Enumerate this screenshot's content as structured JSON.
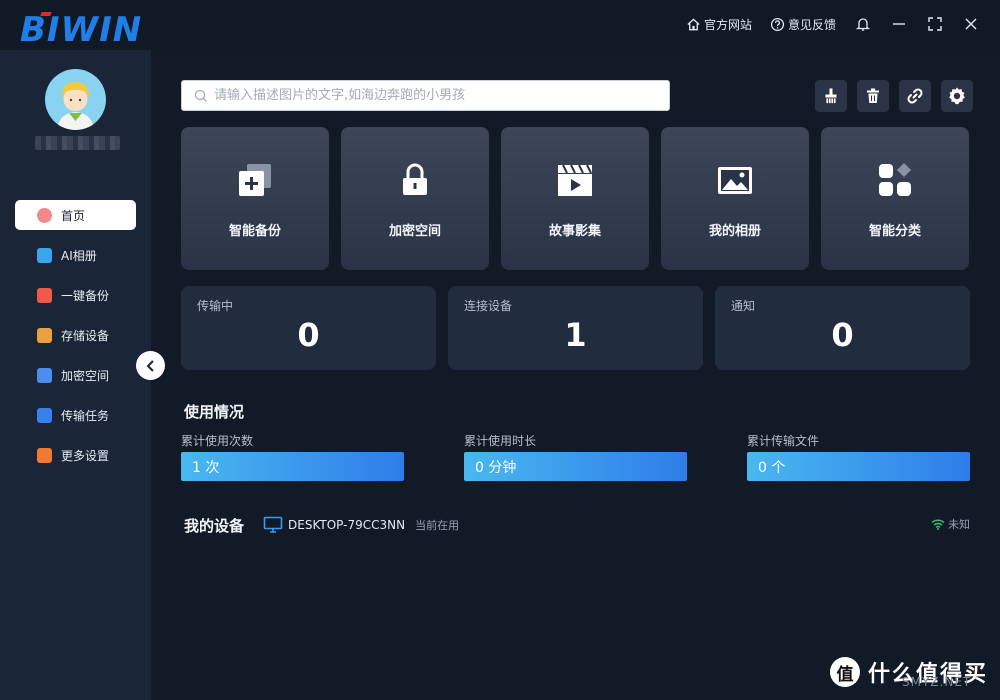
{
  "app": {
    "logo_text": "BIWIN"
  },
  "titlebar": {
    "website_label": "官方网站",
    "feedback_label": "意见反馈"
  },
  "sidebar": {
    "items": [
      {
        "label": "首页",
        "icon": "home-icon",
        "color": "#f08a8a",
        "active": true
      },
      {
        "label": "AI相册",
        "icon": "ai-album-icon",
        "color": "#3aa6f0"
      },
      {
        "label": "一键备份",
        "icon": "backup-icon",
        "color": "#f05a4a"
      },
      {
        "label": "存储设备",
        "icon": "storage-icon",
        "color": "#e8a040"
      },
      {
        "label": "加密空间",
        "icon": "encrypt-icon",
        "color": "#4a8ef0"
      },
      {
        "label": "传输任务",
        "icon": "transfer-icon",
        "color": "#3a7ff0"
      },
      {
        "label": "更多设置",
        "icon": "settings-icon",
        "color": "#f07a30"
      }
    ]
  },
  "search": {
    "placeholder": "请输入描述图片的文字,如海边奔跑的小男孩",
    "value": ""
  },
  "cards": [
    {
      "label": "智能备份",
      "icon": "smart-backup-icon"
    },
    {
      "label": "加密空间",
      "icon": "lock-icon"
    },
    {
      "label": "故事影集",
      "icon": "story-video-icon"
    },
    {
      "label": "我的相册",
      "icon": "photo-album-icon"
    },
    {
      "label": "智能分类",
      "icon": "smart-category-icon"
    }
  ],
  "stats": [
    {
      "label": "传输中",
      "value": "0"
    },
    {
      "label": "连接设备",
      "value": "1"
    },
    {
      "label": "通知",
      "value": "0"
    }
  ],
  "usage": {
    "title": "使用情况",
    "items": [
      {
        "label": "累计使用次数",
        "value": "1 次"
      },
      {
        "label": "累计使用时长",
        "value": "0 分钟"
      },
      {
        "label": "累计传输文件",
        "value": "0 个"
      }
    ]
  },
  "devices": {
    "title": "我的设备",
    "name": "DESKTOP-79CC3NN",
    "status": "当前在用",
    "network": "未知"
  },
  "watermark": {
    "text": "什么值得买",
    "badge": "值",
    "sub": "SMYZ.NET"
  },
  "colors": {
    "accent": "#2e7de9",
    "logo": "#1f7fe6",
    "bg": "#121a28",
    "sidebar": "#1b2538"
  }
}
